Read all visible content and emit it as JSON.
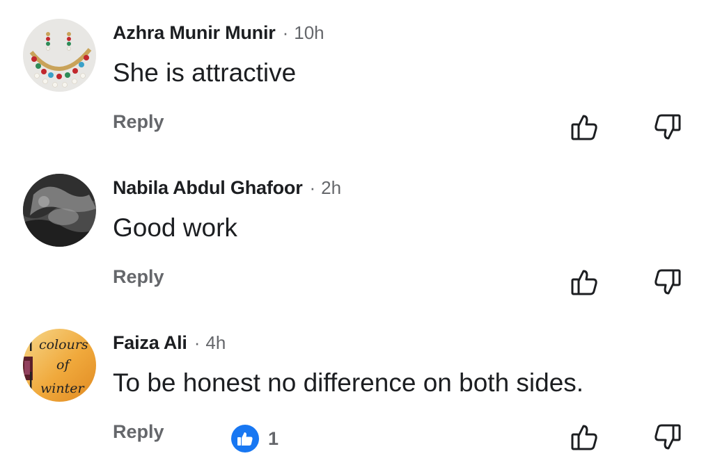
{
  "comments": [
    {
      "author": "Azhra Munir Munir",
      "separator": "·",
      "time": "10h",
      "text": "She is attractive",
      "reply_label": "Reply",
      "avatar_icon": "jewelry-necklace-photo"
    },
    {
      "author": "Nabila Abdul Ghafoor",
      "separator": "·",
      "time": "2h",
      "text": "Good work",
      "reply_label": "Reply",
      "avatar_icon": "grayscale-photo"
    },
    {
      "author": "Faiza Ali",
      "separator": "·",
      "time": "4h",
      "text": "To be honest no difference on both sides.",
      "reply_label": "Reply",
      "reaction_count": "1",
      "avatar_icon": "colours-of-winter-logo",
      "avatar_text": [
        "colours",
        "of",
        "winter"
      ]
    }
  ],
  "icons": {
    "like": "thumbs-up-outline-icon",
    "dislike": "thumbs-down-outline-icon",
    "reaction": "like-reaction-icon"
  },
  "colors": {
    "text_primary": "#1c1e21",
    "text_secondary": "#65676b",
    "like_blue": "#1877f2"
  }
}
